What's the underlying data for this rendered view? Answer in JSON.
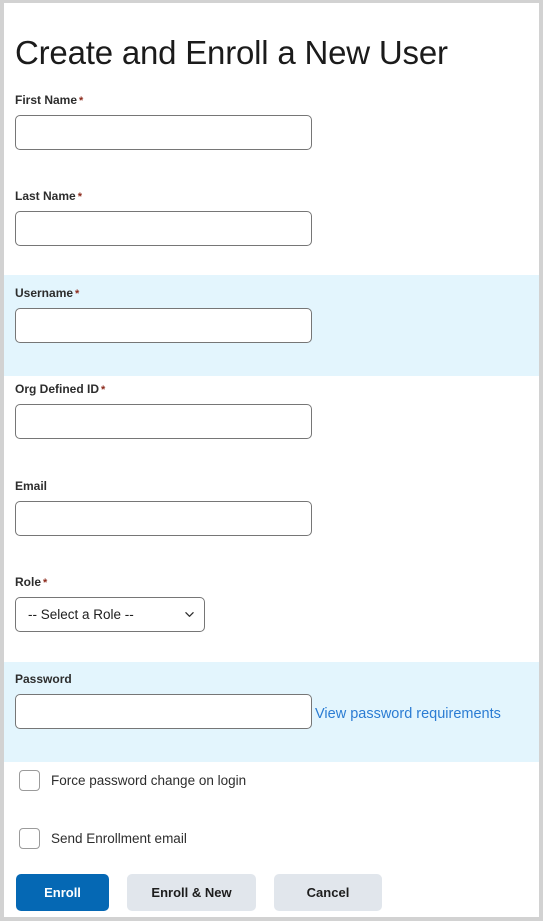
{
  "page": {
    "title": "Create and Enroll a New User",
    "required_marker": "*"
  },
  "colors": {
    "accent_blue": "#0568b4",
    "link_blue": "#2b7cd3",
    "highlight_band": "#e3f5fd",
    "button_secondary": "#e1e6ec",
    "required_asterisk": "#8c2a1c",
    "input_border": "#767676",
    "page_border": "#d2d2d2"
  },
  "form": {
    "fields": [
      {
        "key": "first_name",
        "label": "First Name",
        "required": true,
        "value": "",
        "placeholder": ""
      },
      {
        "key": "last_name",
        "label": "Last Name",
        "required": true,
        "value": "",
        "placeholder": ""
      },
      {
        "key": "username",
        "label": "Username",
        "required": true,
        "value": "",
        "placeholder": "",
        "highlighted": true
      },
      {
        "key": "org_id",
        "label": "Org Defined ID",
        "required": true,
        "value": "",
        "placeholder": ""
      },
      {
        "key": "email",
        "label": "Email",
        "required": false,
        "value": "",
        "placeholder": ""
      },
      {
        "key": "role",
        "label": "Role",
        "required": true,
        "value": "-- Select a Role --"
      },
      {
        "key": "password",
        "label": "Password",
        "required": false,
        "value": "",
        "placeholder": "",
        "highlighted": true
      }
    ],
    "role_select": {
      "selected": "-- Select a Role --",
      "options": [
        "-- Select a Role --"
      ]
    },
    "password_link": "View password requirements",
    "checkboxes": [
      {
        "key": "force_password_change",
        "label": "Force password change on login",
        "checked": false
      },
      {
        "key": "send_enrollment_email",
        "label": "Send Enrollment email",
        "checked": false
      }
    ]
  },
  "buttons": {
    "enroll": "Enroll",
    "enroll_and_new": "Enroll & New",
    "cancel": "Cancel"
  }
}
